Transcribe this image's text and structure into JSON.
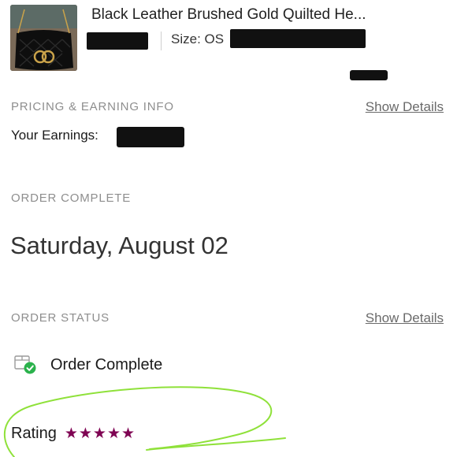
{
  "listing": {
    "title": "Black Leather Brushed Gold Quilted He...",
    "size_label": "Size: OS",
    "thumbnail_icon": "handbag-photo"
  },
  "pricing": {
    "section_label": "PRICING & EARNING INFO",
    "show_details": "Show Details",
    "earnings_label": "Your Earnings:"
  },
  "order": {
    "section_label": "ORDER COMPLETE",
    "date": "Saturday, August 02"
  },
  "status": {
    "section_label": "ORDER STATUS",
    "show_details": "Show Details",
    "text": "Order Complete",
    "icon": "package-check-icon"
  },
  "rating": {
    "label": "Rating",
    "stars": 5,
    "max_stars": 5,
    "star_color": "#7f0353"
  },
  "colors": {
    "check_green": "#2bb24c",
    "annotation_green": "#8fe13a",
    "muted_text": "#8e8e8e"
  }
}
